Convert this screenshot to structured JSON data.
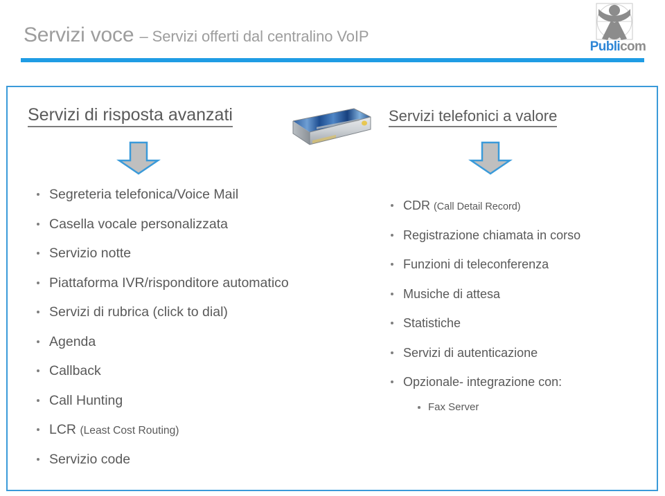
{
  "header": {
    "title_main": "Servizi voce ",
    "title_sub": "– Servizi offerti dal centralino VoIP",
    "rule_color": "#1f9ce4"
  },
  "logo": {
    "name": "Publicom",
    "word_primary": "Publi",
    "word_secondary": "com",
    "primary_color": "#2e86d6",
    "secondary_color": "#8d8d8d",
    "mark_color": "#8c8c8c"
  },
  "frame": {
    "border_color": "#3a9ad9"
  },
  "columns": {
    "left": {
      "heading": "Servizi di risposta avanzati",
      "arrow_icon": "down-arrow-icon",
      "device_image": "pbx-appliance-photo",
      "bullets": [
        {
          "text": "Segreteria telefonica/Voice Mail",
          "note": ""
        },
        {
          "text": "Casella vocale personalizzata",
          "note": ""
        },
        {
          "text": "Servizio notte",
          "note": ""
        },
        {
          "text": "Piattaforma IVR/risponditore automatico",
          "note": ""
        },
        {
          "text": "Servizi di rubrica (click to dial)",
          "note": ""
        },
        {
          "text": "Agenda",
          "note": ""
        },
        {
          "text": "Callback",
          "note": ""
        },
        {
          "text": "Call Hunting",
          "note": ""
        },
        {
          "text": "LCR ",
          "note": "(Least Cost Routing)"
        },
        {
          "text": "Servizio code",
          "note": ""
        }
      ]
    },
    "right": {
      "heading": "Servizi telefonici a valore",
      "arrow_icon": "down-arrow-icon",
      "bullets": [
        {
          "text": "CDR ",
          "note": "(Call Detail Record)"
        },
        {
          "text": "Registrazione chiamata in corso",
          "note": ""
        },
        {
          "text": "Funzioni di teleconferenza",
          "note": ""
        },
        {
          "text": "Musiche di attesa",
          "note": ""
        },
        {
          "text": "Statistiche",
          "note": ""
        },
        {
          "text": "Servizi di autenticazione",
          "note": ""
        },
        {
          "text": "Opzionale- integrazione con:",
          "note": ""
        }
      ],
      "sub_bullets": [
        {
          "text": "Fax Server"
        }
      ]
    }
  },
  "palette": {
    "text_gray": "#595959",
    "heading_gray": "#5a5a5a",
    "title_gray": "#9d9d9d",
    "accent_blue": "#3a9ad9",
    "arrow_fill": "#bfbfbf",
    "arrow_stroke": "#3a9ad9"
  }
}
